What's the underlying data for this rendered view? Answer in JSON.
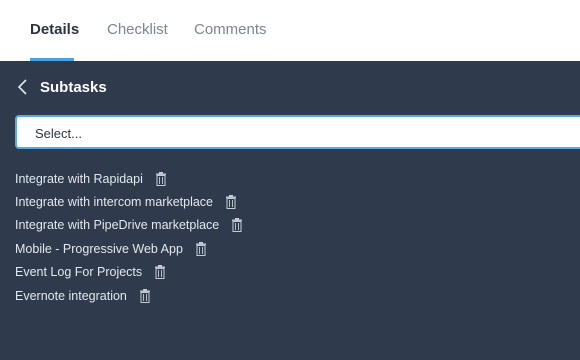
{
  "tabs": [
    {
      "label": "Details",
      "active": true
    },
    {
      "label": "Checklist",
      "active": false
    },
    {
      "label": "Comments",
      "active": false
    }
  ],
  "panel": {
    "title": "Subtasks",
    "back_icon": "chevron-left-icon",
    "select_placeholder": "Select..."
  },
  "subtasks": [
    {
      "label": "Integrate with Rapidapi"
    },
    {
      "label": "Integrate with intercom marketplace"
    },
    {
      "label": "Integrate with PipeDrive marketplace"
    },
    {
      "label": "Mobile - Progressive Web App"
    },
    {
      "label": "Event Log For Projects"
    },
    {
      "label": "Evernote integration"
    }
  ],
  "colors": {
    "accent": "#4aa3df",
    "panel_bg": "#2f3a4c",
    "text_light": "#e4e8ee"
  },
  "item_icon": "trash-icon"
}
